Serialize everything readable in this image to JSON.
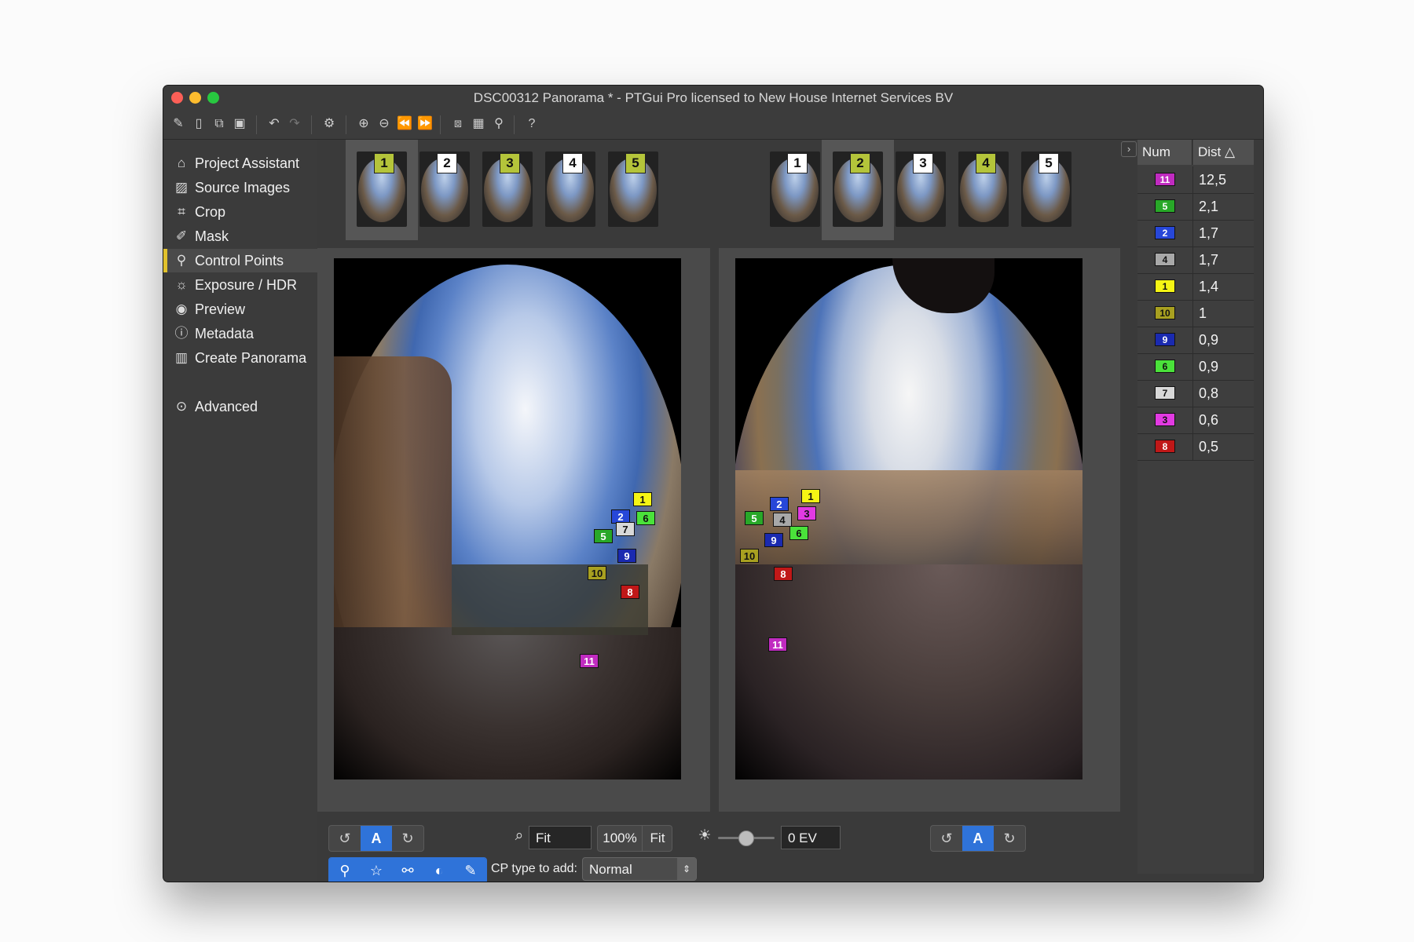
{
  "window": {
    "title": "DSC00312 Panorama * - PTGui Pro licensed to New House Internet Services BV",
    "traffic_lights": [
      "#fc5f57",
      "#fdbc2e",
      "#28c840"
    ]
  },
  "toolbar": {
    "icons": [
      "new-project-icon",
      "open-project-icon",
      "duplicate-icon",
      "save-icon",
      "undo-icon",
      "redo-icon",
      "settings-icon",
      "zoom-in-icon",
      "zoom-out-icon",
      "previous-icon",
      "next-icon",
      "panorama-editor-icon",
      "table-icon",
      "location-icon",
      "help-icon"
    ]
  },
  "sidebar": {
    "items": [
      {
        "label": "Project Assistant",
        "icon": "home-icon"
      },
      {
        "label": "Source Images",
        "icon": "image-icon"
      },
      {
        "label": "Crop",
        "icon": "crop-icon"
      },
      {
        "label": "Mask",
        "icon": "brush-icon"
      },
      {
        "label": "Control Points",
        "icon": "control-points-icon",
        "active": true
      },
      {
        "label": "Exposure / HDR",
        "icon": "sun-icon"
      },
      {
        "label": "Preview",
        "icon": "eye-icon"
      },
      {
        "label": "Metadata",
        "icon": "info-icon"
      },
      {
        "label": "Create Panorama",
        "icon": "panorama-icon"
      },
      {
        "label": "Advanced",
        "icon": "chevron-circle-icon"
      }
    ],
    "active_color": "#e1c12b"
  },
  "left_strip": {
    "thumbnails": [
      {
        "num": "1",
        "color": "#b4c43a",
        "selected": true
      },
      {
        "num": "2",
        "color": "#ffffff"
      },
      {
        "num": "3",
        "color": "#b4c43a"
      },
      {
        "num": "4",
        "color": "#ffffff"
      },
      {
        "num": "5",
        "color": "#b4c43a"
      }
    ]
  },
  "right_strip": {
    "thumbnails": [
      {
        "num": "1",
        "color": "#ffffff"
      },
      {
        "num": "2",
        "color": "#b4c43a",
        "selected": true
      },
      {
        "num": "3",
        "color": "#ffffff"
      },
      {
        "num": "4",
        "color": "#b4c43a"
      },
      {
        "num": "5",
        "color": "#ffffff"
      }
    ]
  },
  "control_points_left": [
    "1",
    "2",
    "6",
    "7",
    "5",
    "9",
    "10",
    "8",
    "11"
  ],
  "control_points_right": [
    "1",
    "2",
    "3",
    "5",
    "4",
    "6",
    "9",
    "10",
    "8",
    "11"
  ],
  "cp_table": {
    "headers": [
      "Num",
      "Dist △"
    ],
    "rows": [
      {
        "num": "11",
        "dist": "12,5",
        "color": "#c02bc0"
      },
      {
        "num": "5",
        "dist": "2,1",
        "color": "#28a828"
      },
      {
        "num": "2",
        "dist": "1,7",
        "color": "#2747d8"
      },
      {
        "num": "4",
        "dist": "1,7",
        "color": "#a8a8a8"
      },
      {
        "num": "1",
        "dist": "1,4",
        "color": "#f5f514"
      },
      {
        "num": "10",
        "dist": "1",
        "color": "#a8a020"
      },
      {
        "num": "9",
        "dist": "0,9",
        "color": "#1a2ab0"
      },
      {
        "num": "6",
        "dist": "0,9",
        "color": "#4ae23a"
      },
      {
        "num": "7",
        "dist": "0,8",
        "color": "#d8d8d8"
      },
      {
        "num": "3",
        "dist": "0,6",
        "color": "#e23ae2"
      },
      {
        "num": "8",
        "dist": "0,5",
        "color": "#c01818"
      }
    ]
  },
  "bottom": {
    "zoom_value": "Fit",
    "zoom_100": "100%",
    "zoom_fit": "Fit",
    "ev_value": "0 EV",
    "auto_label": "A",
    "cp_type_label": "CP type to add:",
    "cp_type_value": "Normal"
  }
}
